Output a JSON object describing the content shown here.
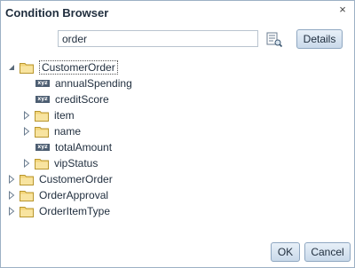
{
  "dialog": {
    "title": "Condition Browser",
    "close_glyph": "×"
  },
  "search": {
    "value": "order",
    "filter_icon": "filter-icon"
  },
  "buttons": {
    "details": "Details",
    "ok": "OK",
    "cancel": "Cancel"
  },
  "tree": {
    "root": {
      "label": "CustomerOrder",
      "expanded": true
    },
    "children": [
      {
        "label": "annualSpending",
        "kind": "attribute"
      },
      {
        "label": "creditScore",
        "kind": "attribute"
      },
      {
        "label": "item",
        "kind": "folder"
      },
      {
        "label": "name",
        "kind": "folder"
      },
      {
        "label": "totalAmount",
        "kind": "attribute"
      },
      {
        "label": "vipStatus",
        "kind": "folder"
      }
    ],
    "siblings": [
      {
        "label": "CustomerOrder"
      },
      {
        "label": "OrderApproval"
      },
      {
        "label": "OrderItemType"
      }
    ],
    "attribute_badge": "xyz"
  }
}
